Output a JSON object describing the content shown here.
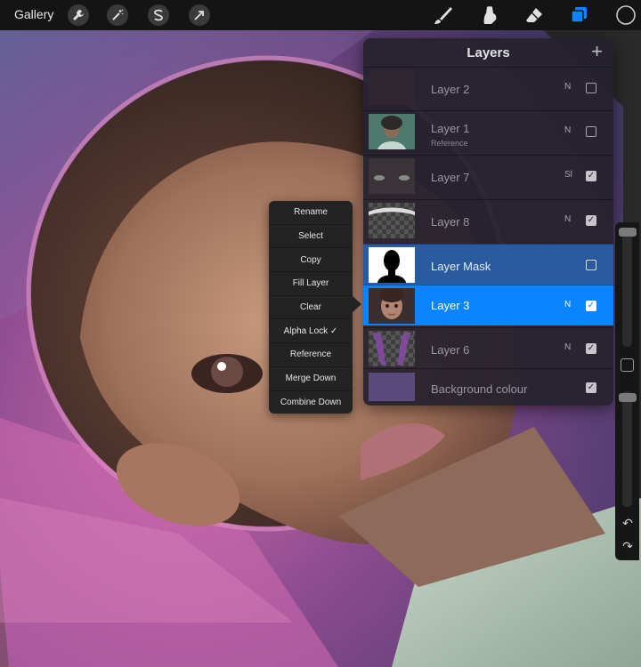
{
  "toolbar": {
    "gallery_label": "Gallery",
    "icons": [
      "wrench-icon",
      "magic-wand-icon",
      "selection-s-icon",
      "transform-arrow-icon",
      "brush-icon",
      "smudge-icon",
      "eraser-icon",
      "layers-icon",
      "color-swatch-icon"
    ],
    "accent_color": "#0a84ff"
  },
  "layers_panel": {
    "title": "Layers",
    "add_symbol": "+",
    "layers": [
      {
        "name": "Layer 2",
        "sublabel": "",
        "blend": "N",
        "visible": false
      },
      {
        "name": "Layer 1",
        "sublabel": "Reference",
        "blend": "N",
        "visible": false
      },
      {
        "name": "Layer 7",
        "sublabel": "",
        "blend": "Sl",
        "visible": true
      },
      {
        "name": "Layer 8",
        "sublabel": "",
        "blend": "N",
        "visible": true
      },
      {
        "name": "Layer Mask",
        "sublabel": "",
        "blend": "",
        "visible": false
      },
      {
        "name": "Layer 3",
        "sublabel": "",
        "blend": "N",
        "visible": true,
        "selected": true
      },
      {
        "name": "Layer 6",
        "sublabel": "",
        "blend": "N",
        "visible": true
      },
      {
        "name": "Background colour",
        "sublabel": "",
        "blend": "",
        "visible": true
      }
    ],
    "check_mark": "✓"
  },
  "context_menu": {
    "items": [
      "Rename",
      "Select",
      "Copy",
      "Fill Layer",
      "Clear",
      "Alpha Lock ✓",
      "Reference",
      "Merge Down",
      "Combine Down"
    ]
  },
  "sidebar": {
    "undo_symbol": "↶",
    "redo_symbol": "↷"
  }
}
